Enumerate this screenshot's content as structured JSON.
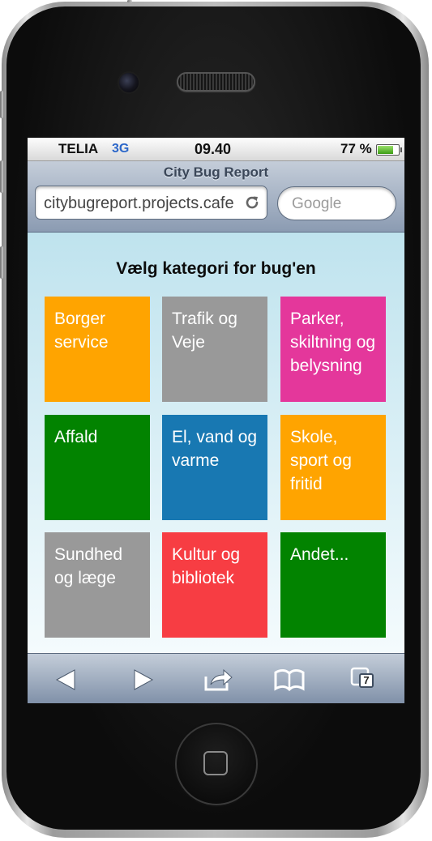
{
  "status_bar": {
    "carrier": "TELIA",
    "network": "3G",
    "time": "09.40",
    "battery_percent": "77 %",
    "battery_level": 0.77
  },
  "browser": {
    "page_title": "City Bug Report",
    "url": "citybugreport.projects.cafe",
    "search_placeholder": "Google",
    "open_tabs": "7"
  },
  "page": {
    "heading": "Vælg kategori for bug'en",
    "categories": [
      {
        "label": "Borger service",
        "color": "#ffa400"
      },
      {
        "label": "Trafik og Veje",
        "color": "#999999"
      },
      {
        "label": "Parker, skiltning og belysning",
        "color": "#e4379b"
      },
      {
        "label": "Affald",
        "color": "#028300"
      },
      {
        "label": "El, vand og varme",
        "color": "#1878b2"
      },
      {
        "label": "Skole, sport og fritid",
        "color": "#ffa400"
      },
      {
        "label": "Sundhed og læge",
        "color": "#999999"
      },
      {
        "label": "Kultur og bibliotek",
        "color": "#f73d43"
      },
      {
        "label": "Andet...",
        "color": "#028300"
      }
    ]
  },
  "toolbar": {
    "icons": [
      "back-arrow-icon",
      "forward-arrow-icon",
      "share-icon",
      "bookmarks-icon",
      "tabs-icon"
    ]
  }
}
